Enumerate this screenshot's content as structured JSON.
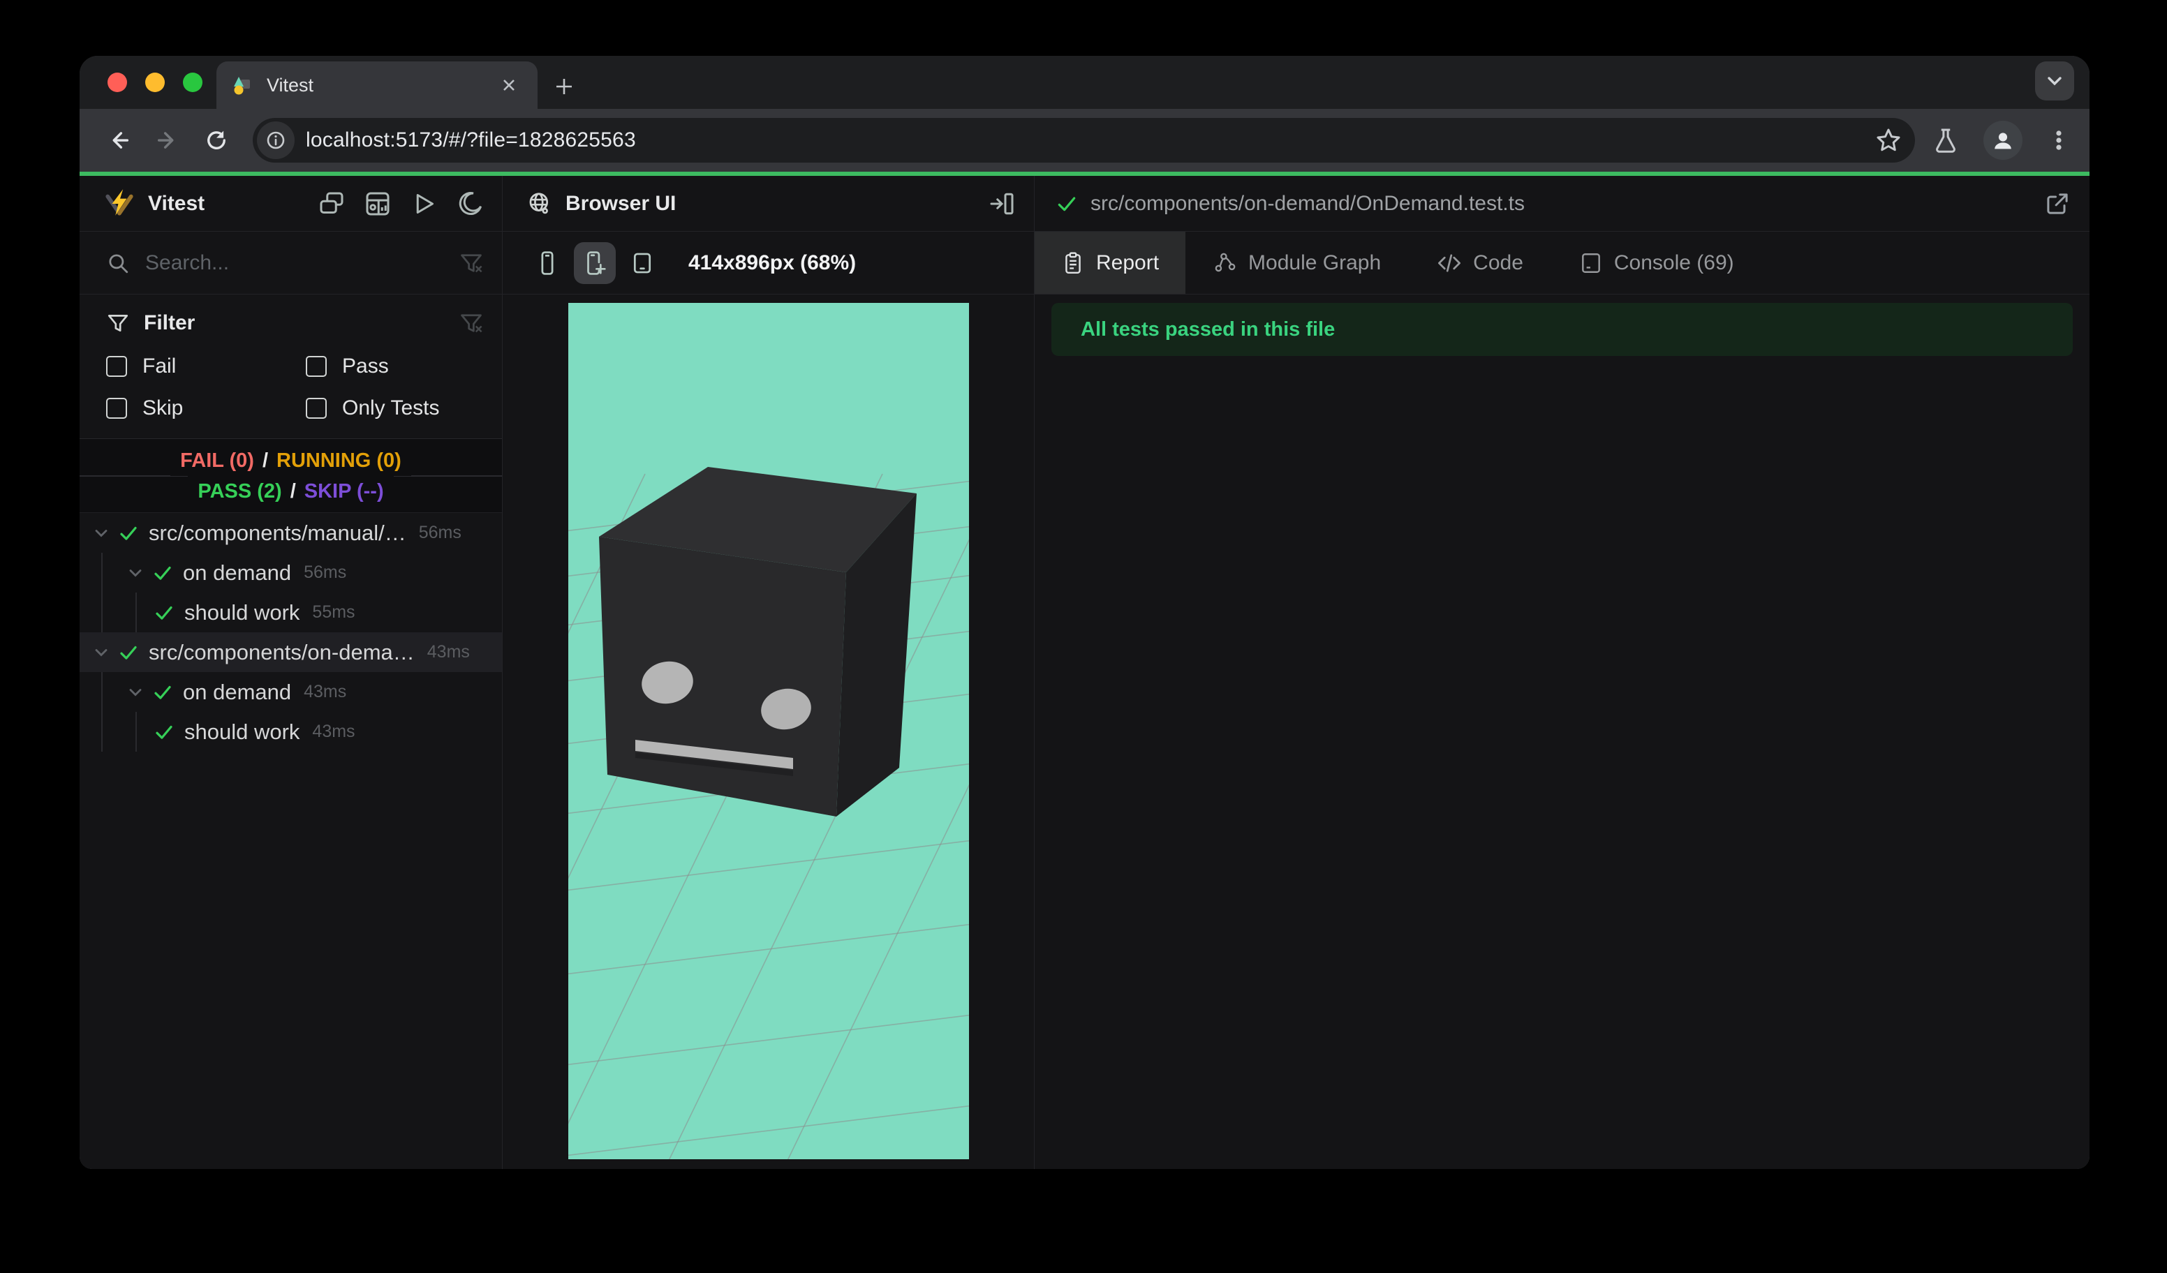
{
  "browser": {
    "tab_title": "Vitest",
    "url": "localhost:5173/#/?file=1828625563"
  },
  "sidebar": {
    "app_title": "Vitest",
    "search_placeholder": "Search...",
    "filter": {
      "title": "Filter",
      "options": [
        "Fail",
        "Pass",
        "Skip",
        "Only Tests"
      ]
    },
    "status": {
      "fail": "FAIL (0)",
      "sep1": "/",
      "running": "RUNNING (0)",
      "pass": "PASS (2)",
      "sep2": "/",
      "skip": "SKIP (--)"
    },
    "tree": [
      {
        "label": "src/components/manual/…",
        "duration": "56ms"
      },
      {
        "label": "on demand",
        "duration": "56ms"
      },
      {
        "label": "should work",
        "duration": "55ms"
      },
      {
        "label": "src/components/on-dema…",
        "duration": "43ms"
      },
      {
        "label": "on demand",
        "duration": "43ms"
      },
      {
        "label": "should work",
        "duration": "43ms"
      }
    ]
  },
  "preview": {
    "title": "Browser UI",
    "viewport_label": "414x896px (68%)"
  },
  "report": {
    "file_path": "src/components/on-demand/OnDemand.test.ts",
    "tabs": [
      {
        "label": "Report"
      },
      {
        "label": "Module Graph"
      },
      {
        "label": "Code"
      },
      {
        "label": "Console (69)"
      }
    ],
    "banner": "All tests passed in this file"
  },
  "colors": {
    "accent_green": "#3dbb61",
    "pass_green": "#36d058",
    "fail_red": "#f16a65",
    "running_yellow": "#e3a008",
    "skip_purple": "#7d4ed8",
    "preview_teal": "#7fdcc1",
    "banner_bg": "#142619",
    "banner_text": "#3ad37f"
  },
  "icons": {
    "tab_favicon": "vitest-logo",
    "sidebar_logo": "vitest-logo",
    "preview_header": "globe-icon",
    "theme_toggle": "moon-icon"
  }
}
